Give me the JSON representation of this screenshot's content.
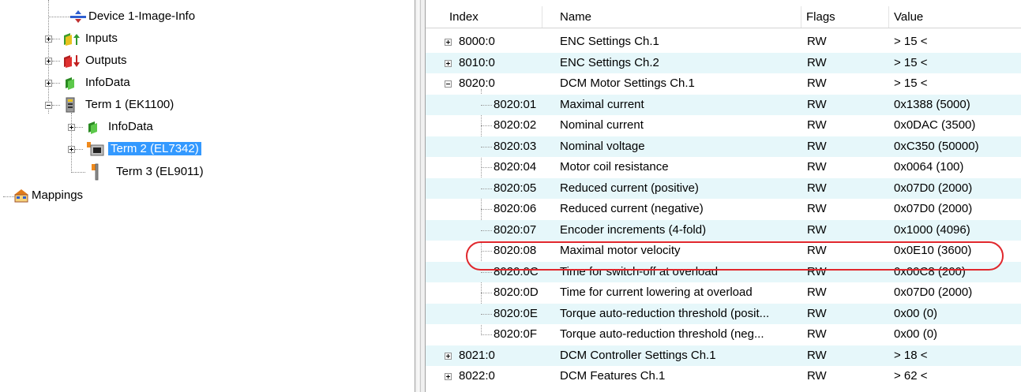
{
  "tree": {
    "items": [
      {
        "label": "Device 1-Image-Info",
        "icon": "image-info-icon"
      },
      {
        "label": "Inputs",
        "icon": "inputs-icon"
      },
      {
        "label": "Outputs",
        "icon": "outputs-icon"
      },
      {
        "label": "InfoData",
        "icon": "infodata-icon"
      },
      {
        "label": "Term 1 (EK1100)",
        "icon": "coupler-icon"
      },
      {
        "label": "InfoData",
        "icon": "infodata-icon"
      },
      {
        "label": "Term 2 (EL7342)",
        "icon": "motor-terminal-icon",
        "selected": true
      },
      {
        "label": "Term 3 (EL9011)",
        "icon": "end-terminal-icon"
      },
      {
        "label": "Mappings",
        "icon": "mappings-icon"
      }
    ]
  },
  "table": {
    "headers": {
      "index": "Index",
      "name": "Name",
      "flags": "Flags",
      "value": "Value"
    },
    "rows": [
      {
        "index": "8000:0",
        "name": "ENC Settings Ch.1",
        "flags": "RW",
        "value": "> 15 <",
        "expander": "plus"
      },
      {
        "index": "8010:0",
        "name": "ENC Settings Ch.2",
        "flags": "RW",
        "value": "> 15 <",
        "expander": "plus"
      },
      {
        "index": "8020:0",
        "name": "DCM Motor Settings Ch.1",
        "flags": "RW",
        "value": "> 15 <",
        "expander": "minus"
      },
      {
        "index": "8020:01",
        "name": "Maximal current",
        "flags": "RW",
        "value": "0x1388 (5000)"
      },
      {
        "index": "8020:02",
        "name": "Nominal current",
        "flags": "RW",
        "value": "0x0DAC (3500)"
      },
      {
        "index": "8020:03",
        "name": "Nominal voltage",
        "flags": "RW",
        "value": "0xC350 (50000)"
      },
      {
        "index": "8020:04",
        "name": "Motor coil resistance",
        "flags": "RW",
        "value": "0x0064 (100)"
      },
      {
        "index": "8020:05",
        "name": "Reduced current (positive)",
        "flags": "RW",
        "value": "0x07D0 (2000)"
      },
      {
        "index": "8020:06",
        "name": "Reduced current (negative)",
        "flags": "RW",
        "value": "0x07D0 (2000)"
      },
      {
        "index": "8020:07",
        "name": "Encoder increments (4-fold)",
        "flags": "RW",
        "value": "0x1000 (4096)"
      },
      {
        "index": "8020:08",
        "name": "Maximal motor velocity",
        "flags": "RW",
        "value": "0x0E10 (3600)"
      },
      {
        "index": "8020:0C",
        "name": "Time for switch-off at overload",
        "flags": "RW",
        "value": "0x00C8 (200)"
      },
      {
        "index": "8020:0D",
        "name": "Time for current lowering at overload",
        "flags": "RW",
        "value": "0x07D0 (2000)"
      },
      {
        "index": "8020:0E",
        "name": "Torque auto-reduction threshold (posit...",
        "flags": "RW",
        "value": "0x00 (0)"
      },
      {
        "index": "8020:0F",
        "name": "Torque auto-reduction threshold (neg...",
        "flags": "RW",
        "value": "0x00 (0)"
      },
      {
        "index": "8021:0",
        "name": "DCM Controller Settings Ch.1",
        "flags": "RW",
        "value": "> 18 <",
        "expander": "plus"
      },
      {
        "index": "8022:0",
        "name": "DCM Features Ch.1",
        "flags": "RW",
        "value": "> 62 <",
        "expander": "plus"
      }
    ]
  },
  "colors": {
    "selection": "#3399ff",
    "alt_row": "#e6f7fa",
    "highlight": "#e0272c"
  }
}
